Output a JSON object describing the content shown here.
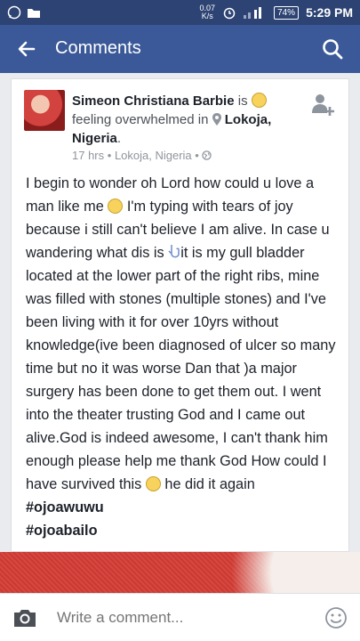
{
  "status_bar": {
    "speed_value": "0.07",
    "speed_unit": "K/s",
    "battery": "74%",
    "time": "5:29 PM"
  },
  "app_bar": {
    "title": "Comments"
  },
  "post": {
    "author": "Simeon Christiana Barbie",
    "is_text": "is",
    "feeling_text": "feeling overwhelmed in",
    "place": "Lokoja, Nigeria",
    "place_suffix": ".",
    "meta_time": "17 hrs",
    "meta_location": "Lokoja, Nigeria",
    "body_lines": [
      "I begin to wonder oh Lord how could u love a man like me",
      "I'm  typing with tears of joy  because i still can't  believe I am alive. In case u wandering what dis is",
      "it is my gull bladder located at the lower part of the right ribs, mine  was filled with stones (multiple stones) and I've been living with it for over 10yrs without knowledge(ive been diagnosed of ulcer so many time but no it was worse Dan that )a major surgery has been done to get them out. I went into the theater trusting God and I came out alive.God is indeed awesome, I can't thank him enough please help me thank God How could I have survived this",
      "he did it again"
    ],
    "hashtags": [
      "#ojoawuwu",
      "#ojoabailo"
    ]
  },
  "comment_bar": {
    "placeholder": "Write a comment..."
  },
  "colors": {
    "header": "#3b5998",
    "status": "#2d4373"
  }
}
